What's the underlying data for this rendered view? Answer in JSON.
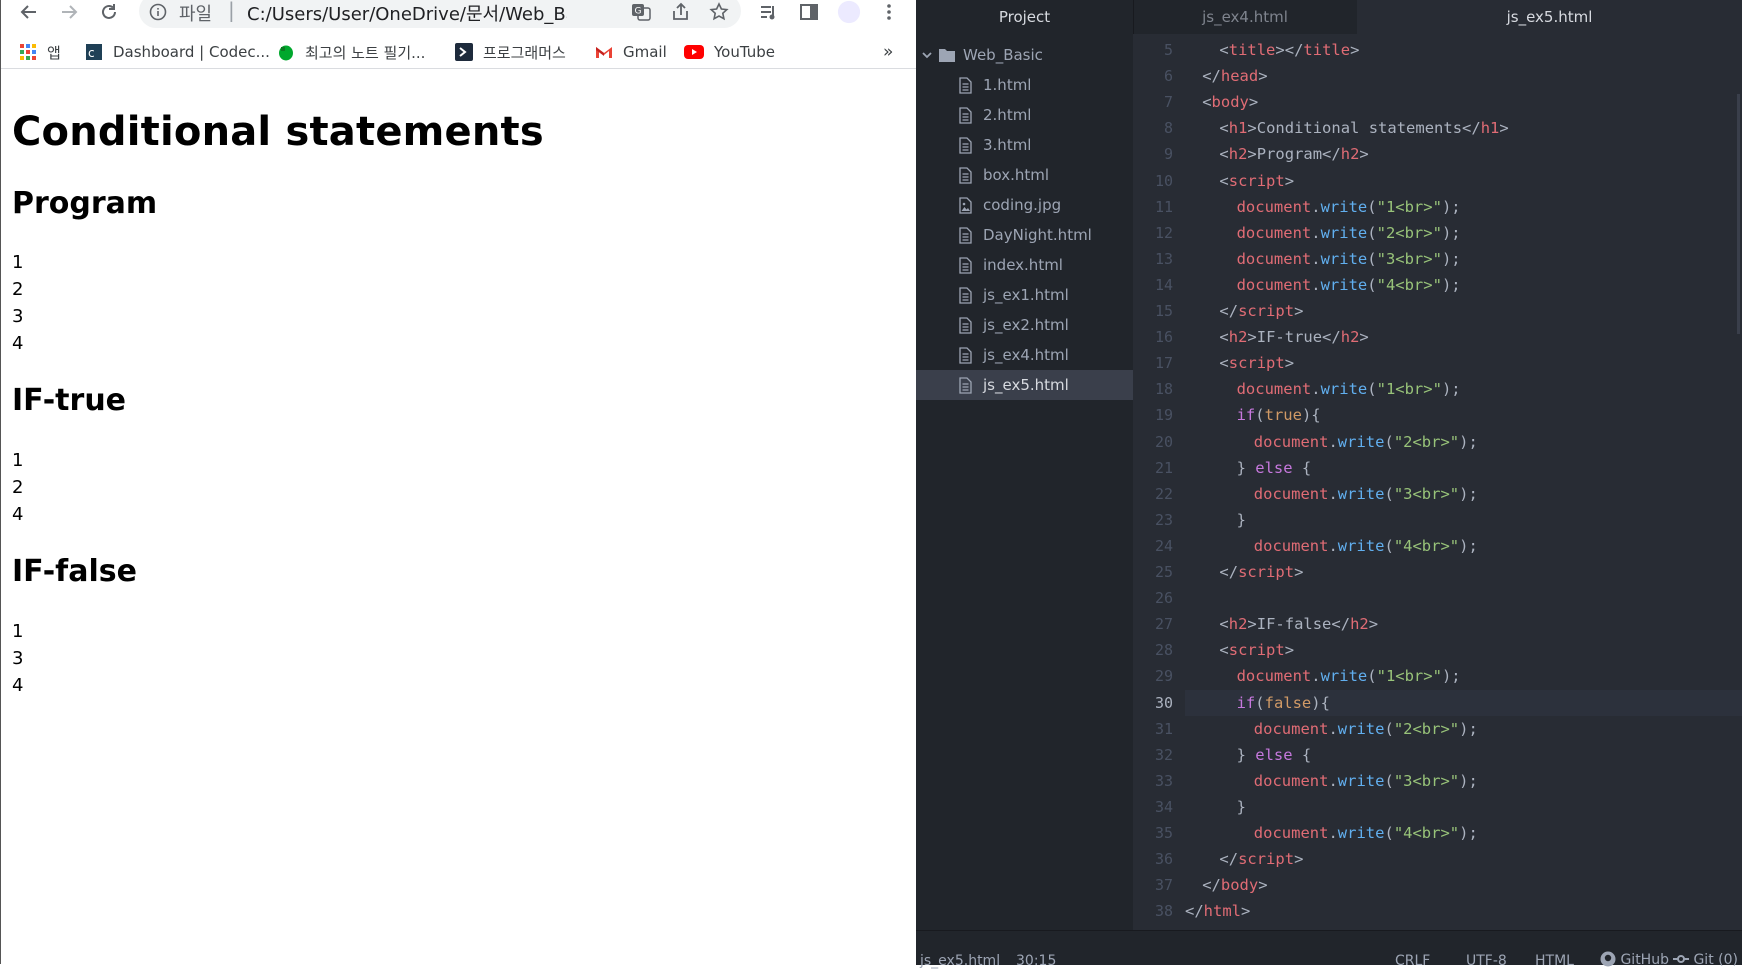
{
  "browser": {
    "omnibox": {
      "scheme": "파일",
      "url": "C:/Users/User/OneDrive/문서/Web_Basic/js_ex..."
    },
    "bookmarks": [
      {
        "label": "앱",
        "icon": "apps-grid-icon"
      },
      {
        "label": "Dashboard | Codec...",
        "icon": "codecademy-icon"
      },
      {
        "label": "최고의 노트 필기...",
        "icon": "evernote-icon"
      },
      {
        "label": "프로그래머스",
        "icon": "programmers-icon"
      },
      {
        "label": "Gmail",
        "icon": "gmail-icon"
      },
      {
        "label": "YouTube",
        "icon": "youtube-icon"
      }
    ],
    "bookmarks_overflow": "»",
    "page": {
      "h1": "Conditional statements",
      "sections": [
        {
          "heading": "Program",
          "lines": [
            "1",
            "2",
            "3",
            "4"
          ]
        },
        {
          "heading": "IF-true",
          "lines": [
            "1",
            "2",
            "4"
          ]
        },
        {
          "heading": "IF-false",
          "lines": [
            "1",
            "3",
            "4"
          ]
        }
      ]
    }
  },
  "editor": {
    "tabs": {
      "project": "Project",
      "file1": "js_ex4.html",
      "file2": "js_ex5.html"
    },
    "tree": {
      "root": "Web_Basic",
      "files": [
        {
          "name": "1.html",
          "icon": "file-text-icon"
        },
        {
          "name": "2.html",
          "icon": "file-text-icon"
        },
        {
          "name": "3.html",
          "icon": "file-text-icon"
        },
        {
          "name": "box.html",
          "icon": "file-text-icon"
        },
        {
          "name": "coding.jpg",
          "icon": "file-image-icon"
        },
        {
          "name": "DayNight.html",
          "icon": "file-text-icon"
        },
        {
          "name": "index.html",
          "icon": "file-text-icon"
        },
        {
          "name": "js_ex1.html",
          "icon": "file-text-icon"
        },
        {
          "name": "js_ex2.html",
          "icon": "file-text-icon"
        },
        {
          "name": "js_ex4.html",
          "icon": "file-text-icon"
        },
        {
          "name": "js_ex5.html",
          "icon": "file-text-icon",
          "selected": true
        }
      ]
    },
    "code_lines": [
      {
        "n": "5",
        "ind": 2,
        "t": [
          [
            "p",
            "<"
          ],
          [
            "tag",
            "title"
          ],
          [
            "p",
            "></"
          ],
          [
            "tag",
            "title"
          ],
          [
            "p",
            ">"
          ]
        ]
      },
      {
        "n": "6",
        "ind": 1,
        "t": [
          [
            "p",
            "</"
          ],
          [
            "tag",
            "head"
          ],
          [
            "p",
            ">"
          ]
        ]
      },
      {
        "n": "7",
        "ind": 1,
        "t": [
          [
            "p",
            "<"
          ],
          [
            "tag",
            "body"
          ],
          [
            "p",
            ">"
          ]
        ]
      },
      {
        "n": "8",
        "ind": 2,
        "t": [
          [
            "p",
            "<"
          ],
          [
            "tag",
            "h1"
          ],
          [
            "p",
            ">Conditional statements</"
          ],
          [
            "tag",
            "h1"
          ],
          [
            "p",
            ">"
          ]
        ]
      },
      {
        "n": "9",
        "ind": 2,
        "t": [
          [
            "p",
            "<"
          ],
          [
            "tag",
            "h2"
          ],
          [
            "p",
            ">Program</"
          ],
          [
            "tag",
            "h2"
          ],
          [
            "p",
            ">"
          ]
        ]
      },
      {
        "n": "10",
        "ind": 2,
        "t": [
          [
            "p",
            "<"
          ],
          [
            "tag",
            "script"
          ],
          [
            "p",
            ">"
          ]
        ]
      },
      {
        "n": "11",
        "ind": 3,
        "t": [
          [
            "doc",
            "document"
          ],
          [
            "p",
            "."
          ],
          [
            "fn",
            "write"
          ],
          [
            "p",
            "("
          ],
          [
            "str",
            "\"1<br>\""
          ],
          [
            "p",
            ");"
          ]
        ]
      },
      {
        "n": "12",
        "ind": 3,
        "t": [
          [
            "doc",
            "document"
          ],
          [
            "p",
            "."
          ],
          [
            "fn",
            "write"
          ],
          [
            "p",
            "("
          ],
          [
            "str",
            "\"2<br>\""
          ],
          [
            "p",
            ");"
          ]
        ]
      },
      {
        "n": "13",
        "ind": 3,
        "t": [
          [
            "doc",
            "document"
          ],
          [
            "p",
            "."
          ],
          [
            "fn",
            "write"
          ],
          [
            "p",
            "("
          ],
          [
            "str",
            "\"3<br>\""
          ],
          [
            "p",
            ");"
          ]
        ]
      },
      {
        "n": "14",
        "ind": 3,
        "t": [
          [
            "doc",
            "document"
          ],
          [
            "p",
            "."
          ],
          [
            "fn",
            "write"
          ],
          [
            "p",
            "("
          ],
          [
            "str",
            "\"4<br>\""
          ],
          [
            "p",
            ");"
          ]
        ]
      },
      {
        "n": "15",
        "ind": 2,
        "t": [
          [
            "p",
            "</"
          ],
          [
            "tag",
            "script"
          ],
          [
            "p",
            ">"
          ]
        ]
      },
      {
        "n": "16",
        "ind": 2,
        "t": [
          [
            "p",
            "<"
          ],
          [
            "tag",
            "h2"
          ],
          [
            "p",
            ">IF-true</"
          ],
          [
            "tag",
            "h2"
          ],
          [
            "p",
            ">"
          ]
        ]
      },
      {
        "n": "17",
        "ind": 2,
        "t": [
          [
            "p",
            "<"
          ],
          [
            "tag",
            "script"
          ],
          [
            "p",
            ">"
          ]
        ]
      },
      {
        "n": "18",
        "ind": 3,
        "t": [
          [
            "doc",
            "document"
          ],
          [
            "p",
            "."
          ],
          [
            "fn",
            "write"
          ],
          [
            "p",
            "("
          ],
          [
            "str",
            "\"1<br>\""
          ],
          [
            "p",
            ");"
          ]
        ]
      },
      {
        "n": "19",
        "ind": 3,
        "t": [
          [
            "kw",
            "if"
          ],
          [
            "p",
            "("
          ],
          [
            "bool",
            "true"
          ],
          [
            "p",
            "){"
          ]
        ]
      },
      {
        "n": "20",
        "ind": 4,
        "t": [
          [
            "doc",
            "document"
          ],
          [
            "p",
            "."
          ],
          [
            "fn",
            "write"
          ],
          [
            "p",
            "("
          ],
          [
            "str",
            "\"2<br>\""
          ],
          [
            "p",
            ");"
          ]
        ]
      },
      {
        "n": "21",
        "ind": 3,
        "t": [
          [
            "p",
            "} "
          ],
          [
            "kw",
            "else"
          ],
          [
            "p",
            " {"
          ]
        ]
      },
      {
        "n": "22",
        "ind": 4,
        "t": [
          [
            "doc",
            "document"
          ],
          [
            "p",
            "."
          ],
          [
            "fn",
            "write"
          ],
          [
            "p",
            "("
          ],
          [
            "str",
            "\"3<br>\""
          ],
          [
            "p",
            ");"
          ]
        ]
      },
      {
        "n": "23",
        "ind": 3,
        "t": [
          [
            "p",
            "}"
          ]
        ]
      },
      {
        "n": "24",
        "ind": 4,
        "t": [
          [
            "doc",
            "document"
          ],
          [
            "p",
            "."
          ],
          [
            "fn",
            "write"
          ],
          [
            "p",
            "("
          ],
          [
            "str",
            "\"4<br>\""
          ],
          [
            "p",
            ");"
          ]
        ]
      },
      {
        "n": "25",
        "ind": 2,
        "t": [
          [
            "p",
            "</"
          ],
          [
            "tag",
            "script"
          ],
          [
            "p",
            ">"
          ]
        ]
      },
      {
        "n": "26",
        "ind": 0,
        "t": []
      },
      {
        "n": "27",
        "ind": 2,
        "t": [
          [
            "p",
            "<"
          ],
          [
            "tag",
            "h2"
          ],
          [
            "p",
            ">IF-false</"
          ],
          [
            "tag",
            "h2"
          ],
          [
            "p",
            ">"
          ]
        ]
      },
      {
        "n": "28",
        "ind": 2,
        "t": [
          [
            "p",
            "<"
          ],
          [
            "tag",
            "script"
          ],
          [
            "p",
            ">"
          ]
        ]
      },
      {
        "n": "29",
        "ind": 3,
        "t": [
          [
            "doc",
            "document"
          ],
          [
            "p",
            "."
          ],
          [
            "fn",
            "write"
          ],
          [
            "p",
            "("
          ],
          [
            "str",
            "\"1<br>\""
          ],
          [
            "p",
            ");"
          ]
        ]
      },
      {
        "n": "30",
        "ind": 3,
        "t": [
          [
            "kw",
            "if"
          ],
          [
            "p",
            "("
          ],
          [
            "bool",
            "false"
          ],
          [
            "p",
            "){"
          ]
        ],
        "current": true
      },
      {
        "n": "31",
        "ind": 4,
        "t": [
          [
            "doc",
            "document"
          ],
          [
            "p",
            "."
          ],
          [
            "fn",
            "write"
          ],
          [
            "p",
            "("
          ],
          [
            "str",
            "\"2<br>\""
          ],
          [
            "p",
            ");"
          ]
        ]
      },
      {
        "n": "32",
        "ind": 3,
        "t": [
          [
            "p",
            "} "
          ],
          [
            "kw",
            "else"
          ],
          [
            "p",
            " {"
          ]
        ]
      },
      {
        "n": "33",
        "ind": 4,
        "t": [
          [
            "doc",
            "document"
          ],
          [
            "p",
            "."
          ],
          [
            "fn",
            "write"
          ],
          [
            "p",
            "("
          ],
          [
            "str",
            "\"3<br>\""
          ],
          [
            "p",
            ");"
          ]
        ]
      },
      {
        "n": "34",
        "ind": 3,
        "t": [
          [
            "p",
            "}"
          ]
        ]
      },
      {
        "n": "35",
        "ind": 4,
        "t": [
          [
            "doc",
            "document"
          ],
          [
            "p",
            "."
          ],
          [
            "fn",
            "write"
          ],
          [
            "p",
            "("
          ],
          [
            "str",
            "\"4<br>\""
          ],
          [
            "p",
            ");"
          ]
        ]
      },
      {
        "n": "36",
        "ind": 2,
        "t": [
          [
            "p",
            "</"
          ],
          [
            "tag",
            "script"
          ],
          [
            "p",
            ">"
          ]
        ]
      },
      {
        "n": "37",
        "ind": 1,
        "t": [
          [
            "p",
            "</"
          ],
          [
            "tag",
            "body"
          ],
          [
            "p",
            ">"
          ]
        ]
      },
      {
        "n": "38",
        "ind": 0,
        "t": [
          [
            "p",
            "</"
          ],
          [
            "tag",
            "html"
          ],
          [
            "p",
            ">"
          ]
        ]
      }
    ],
    "status": {
      "file": "js_ex5.html",
      "cursor": "30:15",
      "line_ending": "CRLF",
      "encoding": "UTF-8",
      "grammar": "HTML",
      "github": "GitHub",
      "git": "Git (0)"
    }
  },
  "colors": {
    "editor_bg": "#282c34",
    "panel_bg": "#21252b",
    "tag": "#e06c75",
    "string": "#98c379",
    "function": "#61afef",
    "keyword": "#c678dd",
    "boolean": "#d19a66"
  }
}
